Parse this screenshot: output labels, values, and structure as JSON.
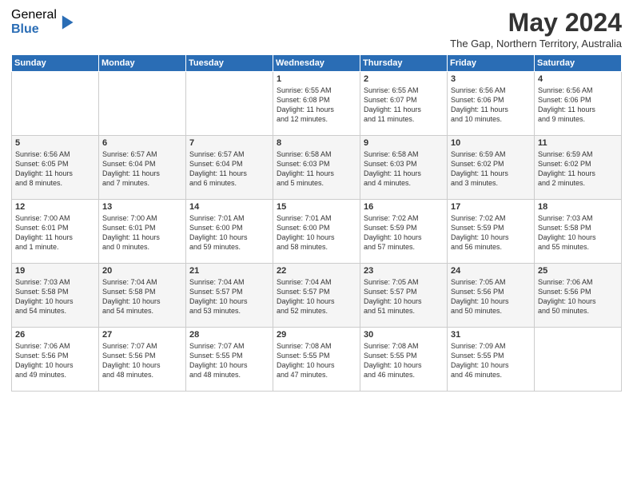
{
  "logo": {
    "general": "General",
    "blue": "Blue"
  },
  "title": "May 2024",
  "subtitle": "The Gap, Northern Territory, Australia",
  "headers": [
    "Sunday",
    "Monday",
    "Tuesday",
    "Wednesday",
    "Thursday",
    "Friday",
    "Saturday"
  ],
  "rows": [
    [
      {
        "day": "",
        "info": ""
      },
      {
        "day": "",
        "info": ""
      },
      {
        "day": "",
        "info": ""
      },
      {
        "day": "1",
        "info": "Sunrise: 6:55 AM\nSunset: 6:08 PM\nDaylight: 11 hours\nand 12 minutes."
      },
      {
        "day": "2",
        "info": "Sunrise: 6:55 AM\nSunset: 6:07 PM\nDaylight: 11 hours\nand 11 minutes."
      },
      {
        "day": "3",
        "info": "Sunrise: 6:56 AM\nSunset: 6:06 PM\nDaylight: 11 hours\nand 10 minutes."
      },
      {
        "day": "4",
        "info": "Sunrise: 6:56 AM\nSunset: 6:06 PM\nDaylight: 11 hours\nand 9 minutes."
      }
    ],
    [
      {
        "day": "5",
        "info": "Sunrise: 6:56 AM\nSunset: 6:05 PM\nDaylight: 11 hours\nand 8 minutes."
      },
      {
        "day": "6",
        "info": "Sunrise: 6:57 AM\nSunset: 6:04 PM\nDaylight: 11 hours\nand 7 minutes."
      },
      {
        "day": "7",
        "info": "Sunrise: 6:57 AM\nSunset: 6:04 PM\nDaylight: 11 hours\nand 6 minutes."
      },
      {
        "day": "8",
        "info": "Sunrise: 6:58 AM\nSunset: 6:03 PM\nDaylight: 11 hours\nand 5 minutes."
      },
      {
        "day": "9",
        "info": "Sunrise: 6:58 AM\nSunset: 6:03 PM\nDaylight: 11 hours\nand 4 minutes."
      },
      {
        "day": "10",
        "info": "Sunrise: 6:59 AM\nSunset: 6:02 PM\nDaylight: 11 hours\nand 3 minutes."
      },
      {
        "day": "11",
        "info": "Sunrise: 6:59 AM\nSunset: 6:02 PM\nDaylight: 11 hours\nand 2 minutes."
      }
    ],
    [
      {
        "day": "12",
        "info": "Sunrise: 7:00 AM\nSunset: 6:01 PM\nDaylight: 11 hours\nand 1 minute."
      },
      {
        "day": "13",
        "info": "Sunrise: 7:00 AM\nSunset: 6:01 PM\nDaylight: 11 hours\nand 0 minutes."
      },
      {
        "day": "14",
        "info": "Sunrise: 7:01 AM\nSunset: 6:00 PM\nDaylight: 10 hours\nand 59 minutes."
      },
      {
        "day": "15",
        "info": "Sunrise: 7:01 AM\nSunset: 6:00 PM\nDaylight: 10 hours\nand 58 minutes."
      },
      {
        "day": "16",
        "info": "Sunrise: 7:02 AM\nSunset: 5:59 PM\nDaylight: 10 hours\nand 57 minutes."
      },
      {
        "day": "17",
        "info": "Sunrise: 7:02 AM\nSunset: 5:59 PM\nDaylight: 10 hours\nand 56 minutes."
      },
      {
        "day": "18",
        "info": "Sunrise: 7:03 AM\nSunset: 5:58 PM\nDaylight: 10 hours\nand 55 minutes."
      }
    ],
    [
      {
        "day": "19",
        "info": "Sunrise: 7:03 AM\nSunset: 5:58 PM\nDaylight: 10 hours\nand 54 minutes."
      },
      {
        "day": "20",
        "info": "Sunrise: 7:04 AM\nSunset: 5:58 PM\nDaylight: 10 hours\nand 54 minutes."
      },
      {
        "day": "21",
        "info": "Sunrise: 7:04 AM\nSunset: 5:57 PM\nDaylight: 10 hours\nand 53 minutes."
      },
      {
        "day": "22",
        "info": "Sunrise: 7:04 AM\nSunset: 5:57 PM\nDaylight: 10 hours\nand 52 minutes."
      },
      {
        "day": "23",
        "info": "Sunrise: 7:05 AM\nSunset: 5:57 PM\nDaylight: 10 hours\nand 51 minutes."
      },
      {
        "day": "24",
        "info": "Sunrise: 7:05 AM\nSunset: 5:56 PM\nDaylight: 10 hours\nand 50 minutes."
      },
      {
        "day": "25",
        "info": "Sunrise: 7:06 AM\nSunset: 5:56 PM\nDaylight: 10 hours\nand 50 minutes."
      }
    ],
    [
      {
        "day": "26",
        "info": "Sunrise: 7:06 AM\nSunset: 5:56 PM\nDaylight: 10 hours\nand 49 minutes."
      },
      {
        "day": "27",
        "info": "Sunrise: 7:07 AM\nSunset: 5:56 PM\nDaylight: 10 hours\nand 48 minutes."
      },
      {
        "day": "28",
        "info": "Sunrise: 7:07 AM\nSunset: 5:55 PM\nDaylight: 10 hours\nand 48 minutes."
      },
      {
        "day": "29",
        "info": "Sunrise: 7:08 AM\nSunset: 5:55 PM\nDaylight: 10 hours\nand 47 minutes."
      },
      {
        "day": "30",
        "info": "Sunrise: 7:08 AM\nSunset: 5:55 PM\nDaylight: 10 hours\nand 46 minutes."
      },
      {
        "day": "31",
        "info": "Sunrise: 7:09 AM\nSunset: 5:55 PM\nDaylight: 10 hours\nand 46 minutes."
      },
      {
        "day": "",
        "info": ""
      }
    ]
  ]
}
